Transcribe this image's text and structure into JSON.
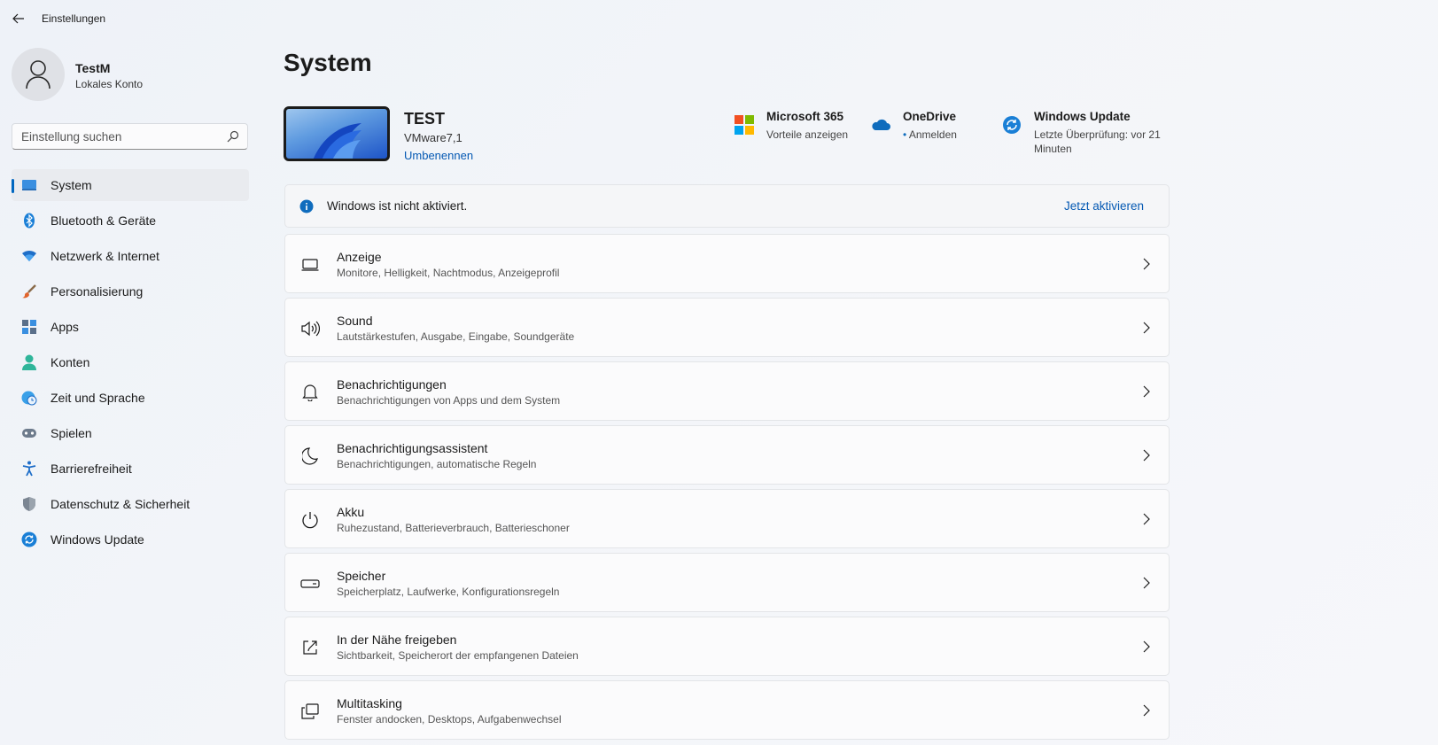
{
  "window": {
    "title": "Einstellungen"
  },
  "user": {
    "name": "TestM",
    "account_type": "Lokales Konto"
  },
  "search": {
    "placeholder": "Einstellung suchen",
    "value": ""
  },
  "nav": {
    "items": [
      {
        "label": "System",
        "icon": "system-icon",
        "active": true
      },
      {
        "label": "Bluetooth & Geräte",
        "icon": "bluetooth-icon"
      },
      {
        "label": "Netzwerk & Internet",
        "icon": "wifi-icon"
      },
      {
        "label": "Personalisierung",
        "icon": "brush-icon"
      },
      {
        "label": "Apps",
        "icon": "apps-icon"
      },
      {
        "label": "Konten",
        "icon": "account-icon"
      },
      {
        "label": "Zeit und Sprache",
        "icon": "globe-clock-icon"
      },
      {
        "label": "Spielen",
        "icon": "gamepad-icon"
      },
      {
        "label": "Barrierefreiheit",
        "icon": "accessibility-icon"
      },
      {
        "label": "Datenschutz & Sicherheit",
        "icon": "shield-icon"
      },
      {
        "label": "Windows Update",
        "icon": "update-icon"
      }
    ]
  },
  "main": {
    "title": "System",
    "device": {
      "name": "TEST",
      "model": "VMware7,1",
      "rename_label": "Umbenennen"
    },
    "quick_links": [
      {
        "title": "Microsoft 365",
        "subtitle": "Vorteile anzeigen",
        "icon": "microsoft-logo-icon"
      },
      {
        "title": "OneDrive",
        "subtitle": "Anmelden",
        "icon": "onedrive-cloud-icon"
      },
      {
        "title": "Windows Update",
        "subtitle_line1": "Letzte Überprüfung: vor 21",
        "subtitle_line2": "Minuten",
        "icon": "update-icon"
      }
    ],
    "activation": {
      "text": "Windows ist nicht aktiviert.",
      "action": "Jetzt aktivieren"
    },
    "cards": [
      {
        "title": "Anzeige",
        "subtitle": "Monitore, Helligkeit, Nachtmodus, Anzeigeprofil",
        "icon": "display-icon"
      },
      {
        "title": "Sound",
        "subtitle": "Lautstärkestufen, Ausgabe, Eingabe, Soundgeräte",
        "icon": "speaker-icon"
      },
      {
        "title": "Benachrichtigungen",
        "subtitle": "Benachrichtigungen von Apps und dem System",
        "icon": "bell-icon"
      },
      {
        "title": "Benachrichtigungsassistent",
        "subtitle": "Benachrichtigungen, automatische Regeln",
        "icon": "moon-icon"
      },
      {
        "title": "Akku",
        "subtitle": "Ruhezustand, Batterieverbrauch, Batterieschoner",
        "icon": "power-icon"
      },
      {
        "title": "Speicher",
        "subtitle": "Speicherplatz, Laufwerke, Konfigurationsregeln",
        "icon": "storage-drive-icon"
      },
      {
        "title": "In der Nähe freigeben",
        "subtitle": "Sichtbarkeit, Speicherort der empfangenen Dateien",
        "icon": "share-icon"
      },
      {
        "title": "Multitasking",
        "subtitle": "Fenster andocken, Desktops, Aufgabenwechsel",
        "icon": "multitasking-icon"
      }
    ]
  },
  "colors": {
    "accent": "#0067c0",
    "link": "#0559b3",
    "background": "#f3f5f9"
  }
}
